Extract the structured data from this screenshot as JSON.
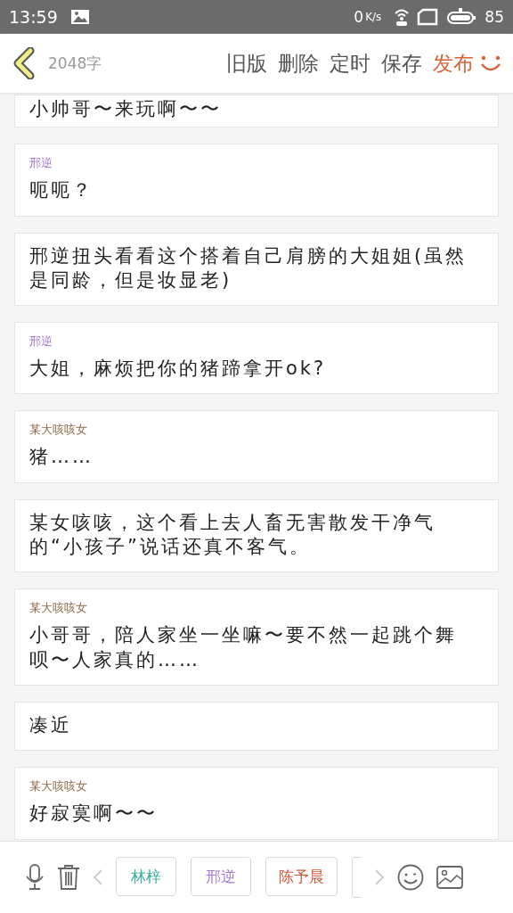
{
  "status_bar": {
    "time": "13:59",
    "speed": "0",
    "speed_unit": "K/s",
    "battery": "85"
  },
  "header": {
    "word_count": "2048字",
    "actions": [
      "旧版",
      "删除",
      "定时",
      "保存"
    ],
    "publish": "发布"
  },
  "entries": [
    {
      "text": "小帅哥〜来玩啊〜〜"
    },
    {
      "speaker": "邢逆",
      "color": "#9b72c8",
      "text": "呃呃？"
    },
    {
      "text": "邢逆扭头看看这个搭着自己肩膀的大姐姐(虽然是同龄，但是妆显老)"
    },
    {
      "speaker": "邢逆",
      "color": "#9b72c8",
      "text": "大姐，麻烦把你的猪蹄拿开ok?"
    },
    {
      "speaker": "某大咳咳女",
      "color": "#8c6a4c",
      "text": "猪……"
    },
    {
      "text": "某女咳咳，这个看上去人畜无害散发干净气的“小孩子”说话还真不客气。"
    },
    {
      "speaker": "某大咳咳女",
      "color": "#8c6a4c",
      "text": "小哥哥，陪人家坐一坐嘛〜要不然一起跳个舞呗〜人家真的……"
    },
    {
      "text": "凑近"
    },
    {
      "speaker": "某大咳咳女",
      "color": "#8c6a4c",
      "text": "好寂寞啊〜〜"
    }
  ],
  "roles": [
    {
      "name": "林梓",
      "color": "#3aaba0"
    },
    {
      "name": "邢逆",
      "color": "#a67ad0"
    },
    {
      "name": "陈予晨",
      "color": "#d0563e"
    }
  ]
}
